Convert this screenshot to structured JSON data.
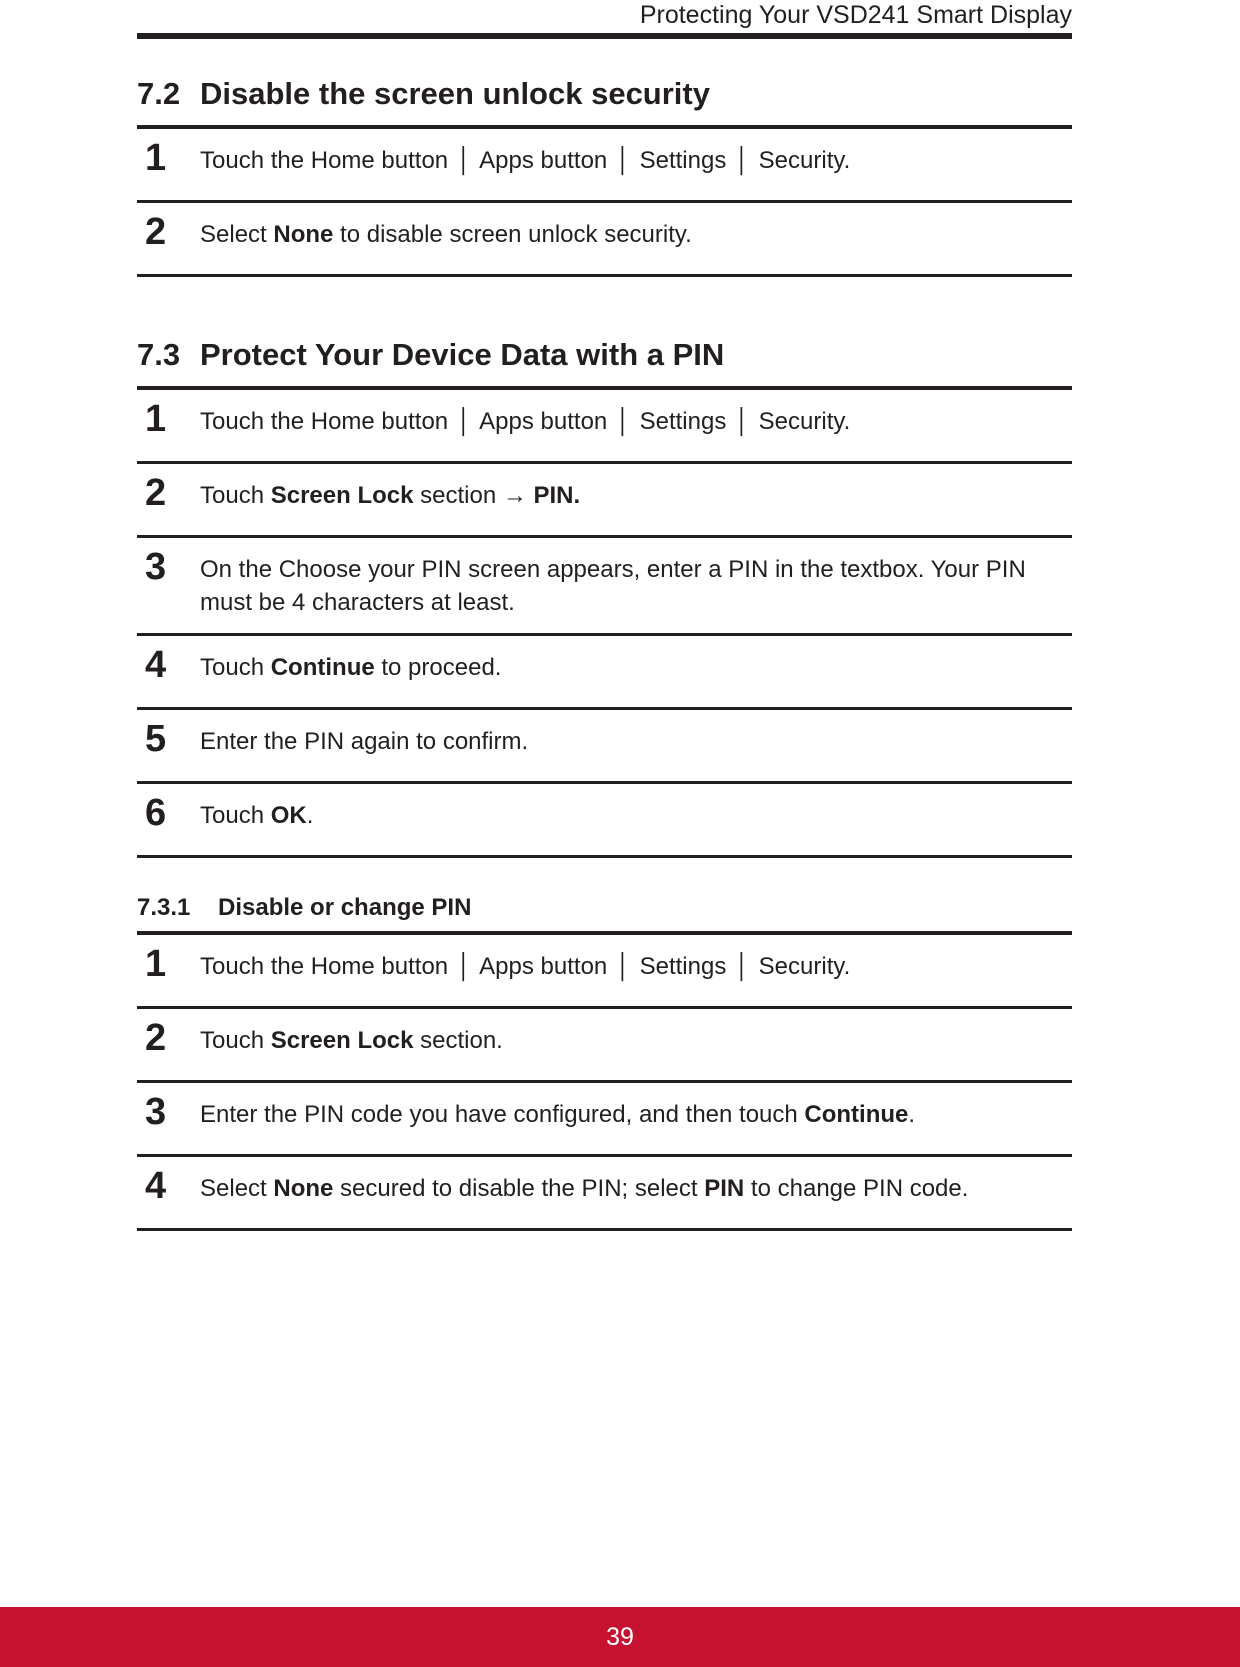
{
  "header": {
    "running_title": "Protecting Your VSD241 Smart Display"
  },
  "colors": {
    "ink": "#231f20",
    "footer_red": "#c51230",
    "footer_text": "#ffffff"
  },
  "sections": [
    {
      "number": "7.2",
      "title": "Disable the screen unlock security",
      "steps": [
        {
          "number": "1",
          "parts": [
            {
              "text": "Touch the Home button ",
              "bold": false
            },
            {
              "text": "│",
              "bold": false,
              "separator": true
            },
            {
              "text": " Apps button  ",
              "bold": false
            },
            {
              "text": "│",
              "bold": false,
              "separator": true
            },
            {
              "text": " Settings ",
              "bold": false
            },
            {
              "text": "│",
              "bold": false,
              "separator": true
            },
            {
              "text": " Security.",
              "bold": false
            }
          ],
          "plain": "Touch the Home button │ Apps button │ Settings │ Security."
        },
        {
          "number": "2",
          "parts": [
            {
              "text": "Select ",
              "bold": false
            },
            {
              "text": "None",
              "bold": true
            },
            {
              "text": " to disable screen unlock security.",
              "bold": false
            }
          ],
          "plain": "Select None to disable screen unlock security."
        }
      ]
    },
    {
      "number": "7.3",
      "title": "Protect Your Device Data with a PIN",
      "steps": [
        {
          "number": "1",
          "parts": [
            {
              "text": "Touch the Home button ",
              "bold": false
            },
            {
              "text": "│",
              "bold": false,
              "separator": true
            },
            {
              "text": " Apps button ",
              "bold": false
            },
            {
              "text": "│",
              "bold": false,
              "separator": true
            },
            {
              "text": " Settings ",
              "bold": false
            },
            {
              "text": "│",
              "bold": false,
              "separator": true
            },
            {
              "text": " Security.",
              "bold": false
            }
          ],
          "plain": "Touch the Home button │ Apps button │ Settings │ Security."
        },
        {
          "number": "2",
          "parts": [
            {
              "text": "Touch ",
              "bold": false
            },
            {
              "text": "Screen Lock",
              "bold": true
            },
            {
              "text": " section → ",
              "bold": false
            },
            {
              "text": "PIN.",
              "bold": true
            }
          ],
          "plain": "Touch Screen Lock section → PIN."
        },
        {
          "number": "3",
          "parts": [
            {
              "text": "On the Choose your PIN screen appears, enter a PIN in the textbox. Your PIN must be 4 characters at least.",
              "bold": false
            }
          ],
          "plain": "On the Choose your PIN screen appears, enter a PIN in the textbox. Your PIN must be 4 characters at least."
        },
        {
          "number": "4",
          "parts": [
            {
              "text": "Touch ",
              "bold": false
            },
            {
              "text": "Continue",
              "bold": true
            },
            {
              "text": " to proceed.",
              "bold": false
            }
          ],
          "plain": "Touch Continue to proceed."
        },
        {
          "number": "5",
          "parts": [
            {
              "text": "Enter the PIN again to confirm.",
              "bold": false
            }
          ],
          "plain": "Enter the PIN again to confirm."
        },
        {
          "number": "6",
          "parts": [
            {
              "text": "Touch ",
              "bold": false
            },
            {
              "text": "OK",
              "bold": true
            },
            {
              "text": ".",
              "bold": false
            }
          ],
          "plain": "Touch OK."
        }
      ]
    }
  ],
  "subsection": {
    "number": "7.3.1",
    "title": "Disable or change PIN",
    "steps": [
      {
        "number": "1",
        "parts": [
          {
            "text": "Touch the Home button ",
            "bold": false
          },
          {
            "text": "│",
            "bold": false,
            "separator": true
          },
          {
            "text": " Apps button ",
            "bold": false
          },
          {
            "text": "│",
            "bold": false,
            "separator": true
          },
          {
            "text": " Settings ",
            "bold": false
          },
          {
            "text": "│",
            "bold": false,
            "separator": true
          },
          {
            "text": " Security.",
            "bold": false
          }
        ],
        "plain": "Touch the Home button │ Apps button │ Settings │ Security."
      },
      {
        "number": "2",
        "parts": [
          {
            "text": "Touch ",
            "bold": false
          },
          {
            "text": "Screen Lock",
            "bold": true
          },
          {
            "text": " section.",
            "bold": false
          }
        ],
        "plain": "Touch Screen Lock section."
      },
      {
        "number": "3",
        "parts": [
          {
            "text": "Enter the PIN code you have configured, and then touch ",
            "bold": false
          },
          {
            "text": "Continue",
            "bold": true
          },
          {
            "text": ".",
            "bold": false
          }
        ],
        "plain": "Enter the PIN code you have configured, and then touch Continue."
      },
      {
        "number": "4",
        "parts": [
          {
            "text": "Select ",
            "bold": false
          },
          {
            "text": "None",
            "bold": true
          },
          {
            "text": " secured to disable the PIN; select ",
            "bold": false
          },
          {
            "text": "PIN",
            "bold": true
          },
          {
            "text": " to change PIN code.",
            "bold": false
          }
        ],
        "plain": "Select None secured to disable the PIN; select PIN to change PIN code."
      }
    ]
  },
  "footer": {
    "page_number": "39"
  }
}
